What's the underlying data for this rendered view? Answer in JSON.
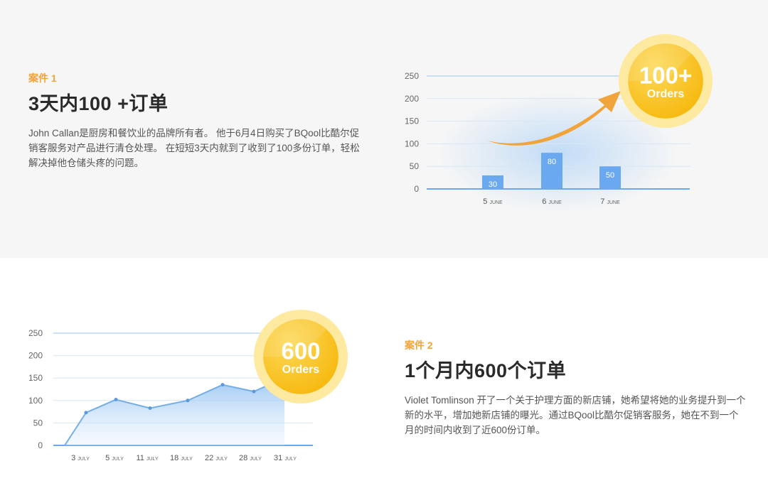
{
  "case1": {
    "label": "案件 1",
    "title": "3天内100 +订单",
    "description": "John Callan是厨房和餐饮业的品牌所有者。 他于6月4日购买了BQool比酷尔促销客服务对产品进行清仓处理。 在短短3天内就到了收到了100多份订单，轻松解决掉他仓储头疼的问题。"
  },
  "case2": {
    "label": "案件 2",
    "title": "1个月内600个订单",
    "description": "Violet Tomlinson 开了一个关于护理方面的新店铺，她希望将她的业务提升到一个新的水平，增加她新店铺的曝光。通过BQool比酷尔促销客服务，她在不到一个月的时间内收到了近600份订单。"
  },
  "colors": {
    "accent": "#f0a43a",
    "bar": "#6aa9f0",
    "line": "#74aee6",
    "badge_outer": "#fde9a0",
    "badge_inner": "#fbc71e",
    "arrow": "#f0a43a"
  },
  "chart_data": [
    {
      "type": "bar",
      "categories": [
        "5",
        "6",
        "7"
      ],
      "category_suffix": "JUNE",
      "values": [
        30,
        80,
        50
      ],
      "yticks": [
        0,
        50,
        100,
        150,
        200,
        250
      ],
      "ylim": [
        0,
        250
      ],
      "badge": {
        "value": "100+",
        "unit": "Orders"
      }
    },
    {
      "type": "area",
      "categories": [
        "3",
        "5",
        "11",
        "18",
        "22",
        "28",
        "31"
      ],
      "category_suffix": "JULY",
      "values": [
        0,
        73,
        102,
        83,
        100,
        135,
        120,
        150
      ],
      "yticks": [
        0,
        50,
        100,
        150,
        200,
        250
      ],
      "ylim": [
        0,
        250
      ],
      "badge": {
        "value": "600",
        "unit": "Orders"
      }
    }
  ]
}
